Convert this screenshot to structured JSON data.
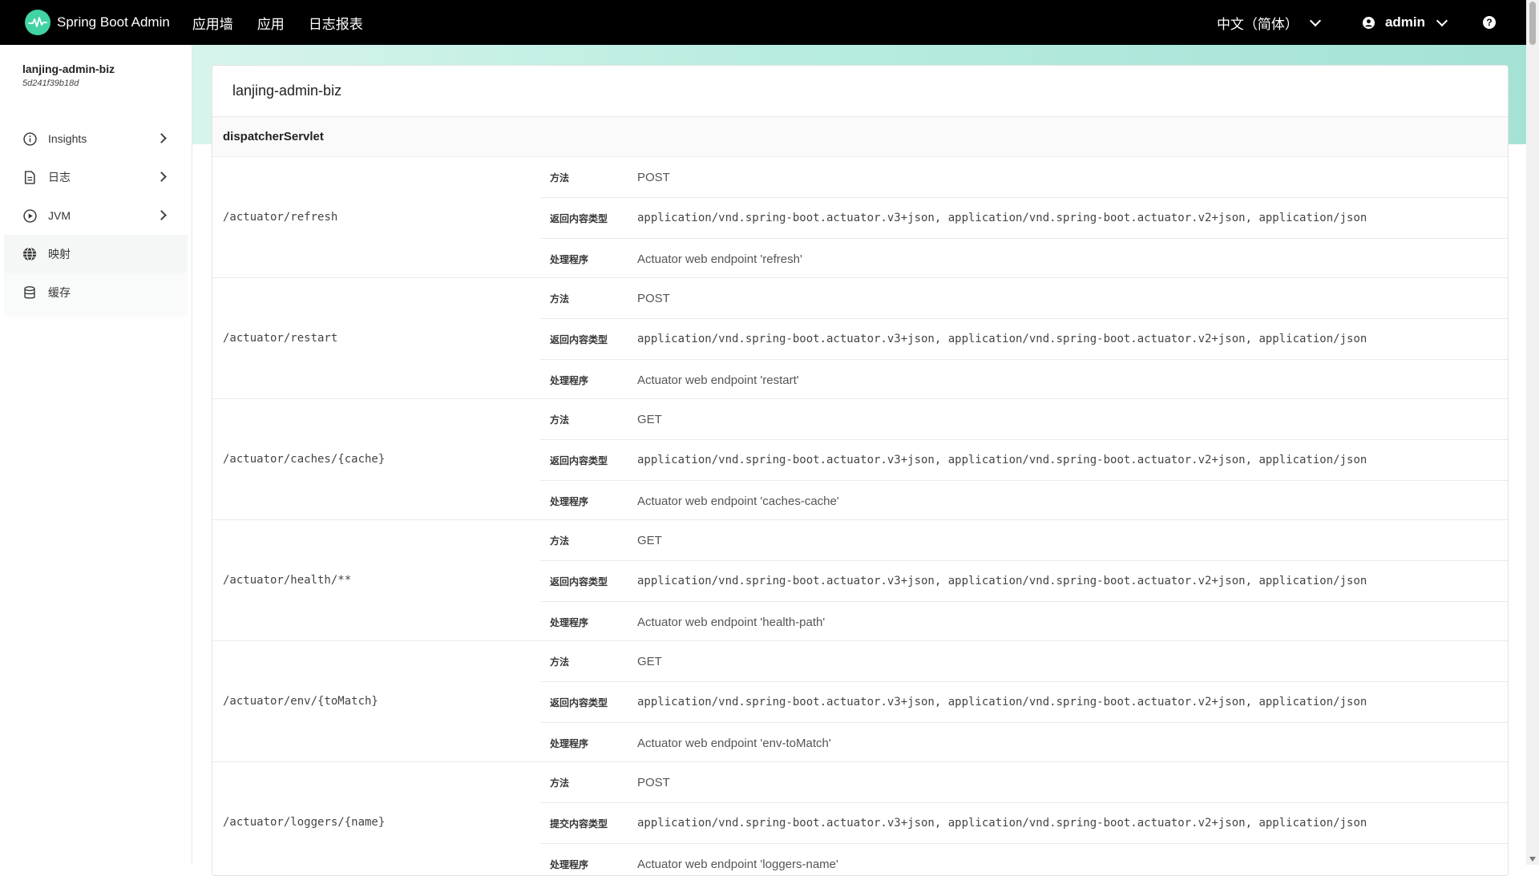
{
  "navbar": {
    "brand_title": "Spring Boot Admin",
    "items": [
      {
        "label": "应用墙"
      },
      {
        "label": "应用"
      },
      {
        "label": "日志报表"
      }
    ],
    "language": "中文（简体）",
    "user": "admin",
    "help": "?"
  },
  "sidebar": {
    "app_name": "lanjing-admin-biz",
    "app_id": "5d241f39b18d",
    "items": [
      {
        "label": "Insights",
        "icon": "info-icon"
      },
      {
        "label": "日志",
        "icon": "file-icon"
      },
      {
        "label": "JVM",
        "icon": "play-circle-icon"
      },
      {
        "label": "映射",
        "icon": "globe-icon"
      },
      {
        "label": "缓存",
        "icon": "database-icon"
      }
    ]
  },
  "main": {
    "title": "lanjing-admin-biz",
    "servlet_name": "dispatcherServlet",
    "mappings": [
      {
        "path": "/actuator/refresh",
        "rows": [
          {
            "label": "方法",
            "value": "POST"
          },
          {
            "label": "返回内容类型",
            "value": "application/vnd.spring-boot.actuator.v3+json, application/vnd.spring-boot.actuator.v2+json, application/json"
          },
          {
            "label": "处理程序",
            "value": "Actuator web endpoint 'refresh'"
          }
        ]
      },
      {
        "path": "/actuator/restart",
        "rows": [
          {
            "label": "方法",
            "value": "POST"
          },
          {
            "label": "返回内容类型",
            "value": "application/vnd.spring-boot.actuator.v3+json, application/vnd.spring-boot.actuator.v2+json, application/json"
          },
          {
            "label": "处理程序",
            "value": "Actuator web endpoint 'restart'"
          }
        ]
      },
      {
        "path": "/actuator/caches/{cache}",
        "rows": [
          {
            "label": "方法",
            "value": "GET"
          },
          {
            "label": "返回内容类型",
            "value": "application/vnd.spring-boot.actuator.v3+json, application/vnd.spring-boot.actuator.v2+json, application/json"
          },
          {
            "label": "处理程序",
            "value": "Actuator web endpoint 'caches-cache'"
          }
        ]
      },
      {
        "path": "/actuator/health/**",
        "rows": [
          {
            "label": "方法",
            "value": "GET"
          },
          {
            "label": "返回内容类型",
            "value": "application/vnd.spring-boot.actuator.v3+json, application/vnd.spring-boot.actuator.v2+json, application/json"
          },
          {
            "label": "处理程序",
            "value": "Actuator web endpoint 'health-path'"
          }
        ]
      },
      {
        "path": "/actuator/env/{toMatch}",
        "rows": [
          {
            "label": "方法",
            "value": "GET"
          },
          {
            "label": "返回内容类型",
            "value": "application/vnd.spring-boot.actuator.v3+json, application/vnd.spring-boot.actuator.v2+json, application/json"
          },
          {
            "label": "处理程序",
            "value": "Actuator web endpoint 'env-toMatch'"
          }
        ]
      },
      {
        "path": "/actuator/loggers/{name}",
        "rows": [
          {
            "label": "方法",
            "value": "POST"
          },
          {
            "label": "提交内容类型",
            "value": "application/vnd.spring-boot.actuator.v3+json, application/vnd.spring-boot.actuator.v2+json, application/json"
          },
          {
            "label": "处理程序",
            "value": "Actuator web endpoint 'loggers-name'"
          }
        ]
      }
    ]
  },
  "colors": {
    "accent": "#42d3a5",
    "navbar_bg": "#000000"
  }
}
